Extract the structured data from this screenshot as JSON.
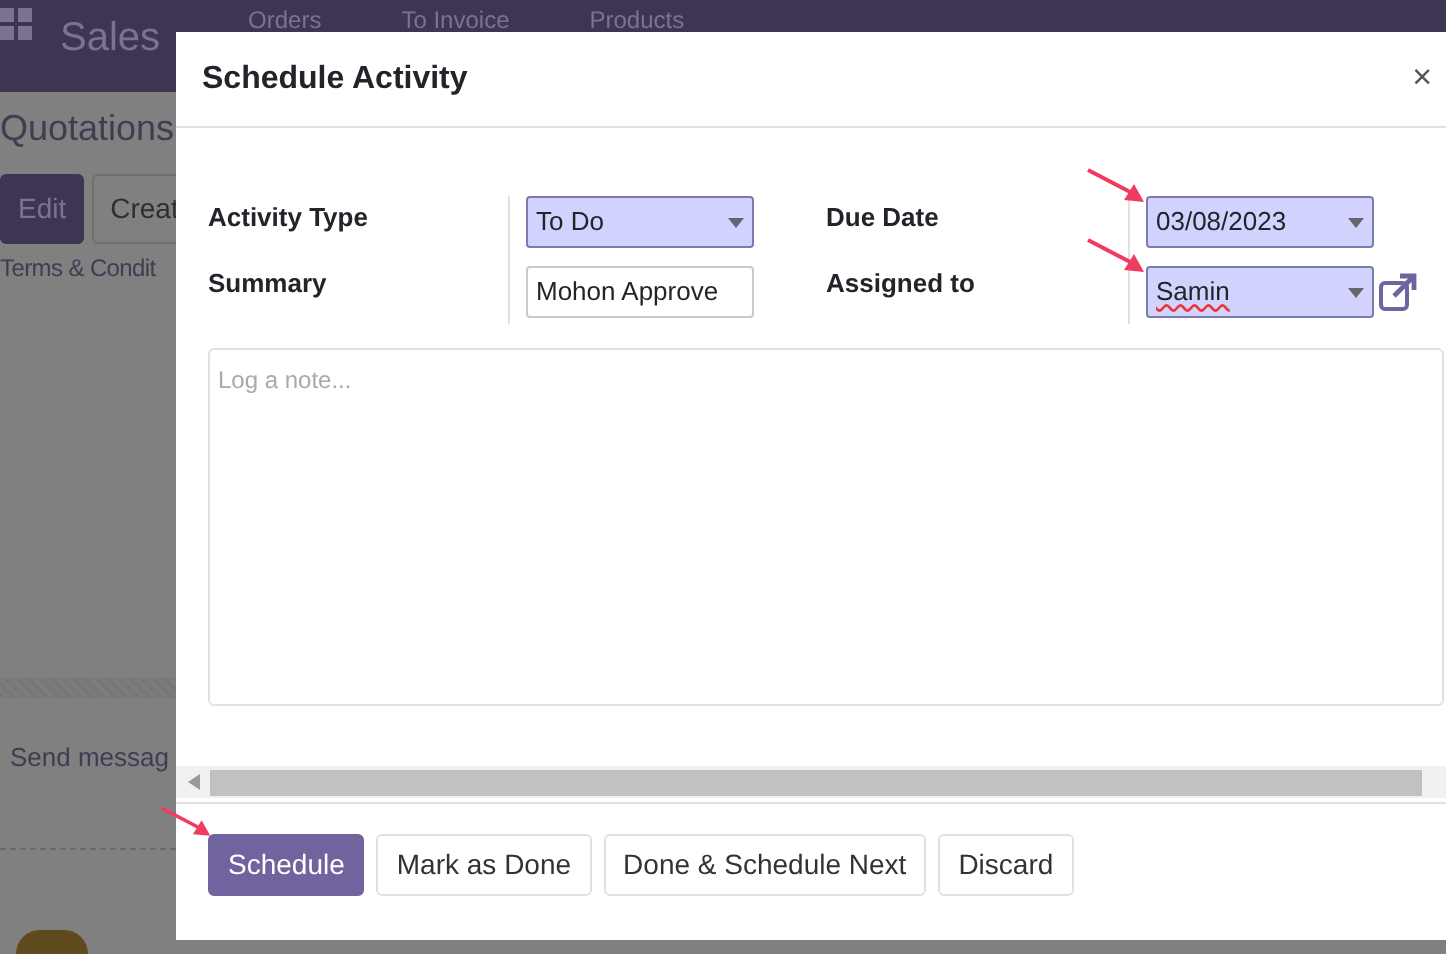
{
  "app": {
    "title": "Sales",
    "menu": [
      "Orders",
      "To Invoice",
      "Products"
    ]
  },
  "background": {
    "breadcrumb": "Quotations",
    "buttons": [
      {
        "label": "Edit",
        "primary": true
      },
      {
        "label": "Creat",
        "primary": false
      }
    ],
    "tab": "Terms & Condit",
    "chatter_action": "Send messag"
  },
  "dialog": {
    "title": "Schedule Activity",
    "close": "×",
    "left_fields": [
      {
        "label": "Activity Type",
        "kind": "select",
        "value": "To Do",
        "required": true,
        "highlighted": false,
        "misspelled": false
      },
      {
        "label": "Summary",
        "kind": "text",
        "value": "Mohon Approve",
        "required": false,
        "highlighted": false,
        "misspelled": false
      }
    ],
    "right_fields": [
      {
        "label": "Due Date",
        "kind": "select",
        "value": "03/08/2023",
        "required": true,
        "highlighted": true,
        "misspelled": false
      },
      {
        "label": "Assigned to",
        "kind": "select",
        "value": "Samin",
        "required": true,
        "highlighted": true,
        "misspelled": true,
        "external_link": true
      }
    ],
    "note": {
      "placeholder": "Log a note..."
    },
    "buttons": [
      {
        "label": "Schedule",
        "primary": true,
        "highlighted": true
      },
      {
        "label": "Mark as Done",
        "primary": false,
        "highlighted": false
      },
      {
        "label": "Done & Schedule Next",
        "primary": false,
        "highlighted": false
      },
      {
        "label": "Discard",
        "primary": false,
        "highlighted": false
      }
    ]
  }
}
